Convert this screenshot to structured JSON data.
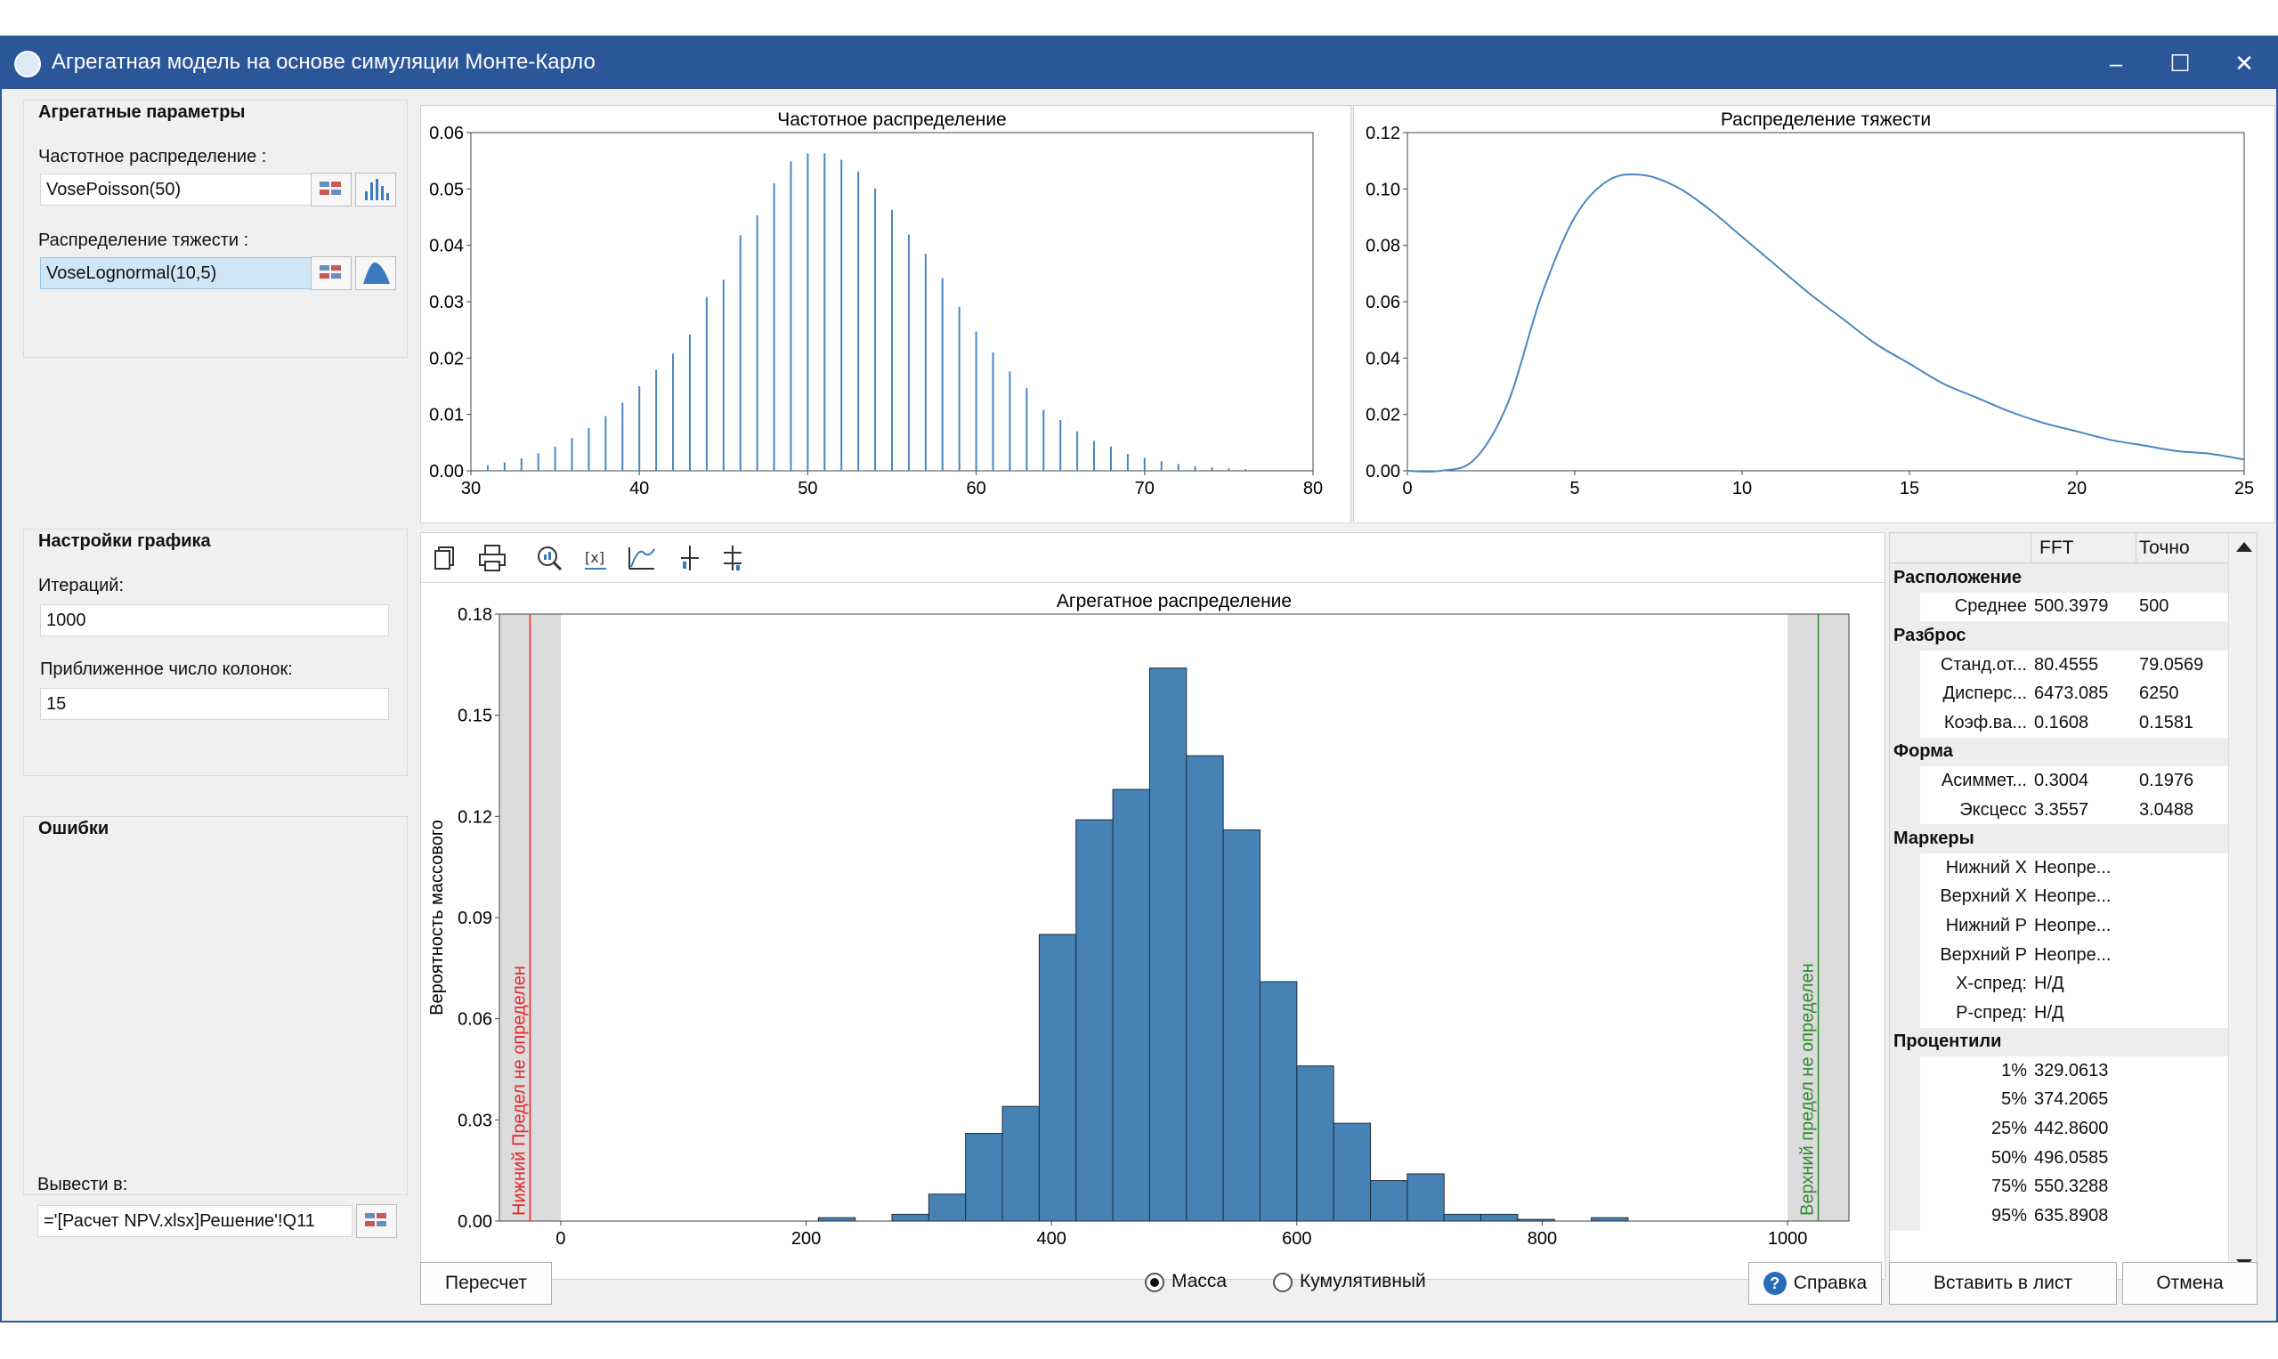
{
  "window": {
    "title": "Агрегатная модель на основе симуляции Монте-Карло",
    "minimize": "–",
    "maximize": "☐",
    "close": "✕"
  },
  "params": {
    "title": "Агрегатные параметры",
    "freq_label": "Частотное распределение :",
    "freq_value": "VosePoisson(50)",
    "sev_label": "Распределение тяжести :",
    "sev_value": "VoseLognormal(10,5)"
  },
  "graph_settings": {
    "title": "Настройки графика",
    "iter_label": "Итераций:",
    "iter_value": "1000",
    "cols_label": "Приближенное число колонок:",
    "cols_value": "15"
  },
  "errors": {
    "title": "Ошибки"
  },
  "output": {
    "label": "Вывести в:",
    "value": "='[Расчет NPV.xlsx]Решение'!Q11"
  },
  "buttons": {
    "recalc": "Пересчет",
    "help": "Справка",
    "insert": "Вставить в лист",
    "cancel": "Отмена"
  },
  "mode": {
    "mass": "Масса",
    "cumulative": "Кумулятивный",
    "selected": "mass"
  },
  "stats": {
    "col_fft": "FFT",
    "col_exact": "Точно",
    "sections": [
      {
        "title": "Расположение",
        "rows": [
          {
            "label": "Среднее",
            "fft": "500.3979",
            "exact": "500"
          }
        ]
      },
      {
        "title": "Разброс",
        "rows": [
          {
            "label": "Станд.от...",
            "fft": "80.4555",
            "exact": "79.0569"
          },
          {
            "label": "Дисперс...",
            "fft": "6473.085",
            "exact": "6250"
          },
          {
            "label": "Коэф.ва...",
            "fft": "0.1608",
            "exact": "0.1581"
          }
        ]
      },
      {
        "title": "Форма",
        "rows": [
          {
            "label": "Асиммет...",
            "fft": "0.3004",
            "exact": "0.1976"
          },
          {
            "label": "Эксцесс",
            "fft": "3.3557",
            "exact": "3.0488"
          }
        ]
      },
      {
        "title": "Маркеры",
        "rows": [
          {
            "label": "Нижний X",
            "fft": "Неопре...",
            "exact": ""
          },
          {
            "label": "Верхний X",
            "fft": "Неопре...",
            "exact": ""
          },
          {
            "label": "Нижний P",
            "fft": "Неопре...",
            "exact": ""
          },
          {
            "label": "Верхний P",
            "fft": "Неопре...",
            "exact": ""
          },
          {
            "label": "X-спред:",
            "fft": "Н/Д",
            "exact": ""
          },
          {
            "label": "P-спред:",
            "fft": "Н/Д",
            "exact": ""
          }
        ]
      },
      {
        "title": "Процентили",
        "rows": [
          {
            "label": "1%",
            "fft": "329.0613",
            "exact": ""
          },
          {
            "label": "5%",
            "fft": "374.2065",
            "exact": ""
          },
          {
            "label": "25%",
            "fft": "442.8600",
            "exact": ""
          },
          {
            "label": "50%",
            "fft": "496.0585",
            "exact": ""
          },
          {
            "label": "75%",
            "fft": "550.3288",
            "exact": ""
          },
          {
            "label": "95%",
            "fft": "635.8908",
            "exact": ""
          }
        ]
      }
    ]
  },
  "colors": {
    "accent": "#2b579a",
    "bar": "#4682b4",
    "line": "#4a86c0",
    "lower": "#e8272c",
    "upper": "#2e8b2e"
  },
  "chart_data": [
    {
      "type": "bar",
      "title": "Частотное распределение",
      "xlim": [
        30,
        80
      ],
      "ylim": [
        0,
        0.06
      ],
      "xticks": [
        "30",
        "40",
        "50",
        "60",
        "70",
        "80"
      ],
      "yticks": [
        "0.00",
        "0.01",
        "0.02",
        "0.03",
        "0.04",
        "0.05",
        "0.06"
      ],
      "x": [
        31,
        32,
        33,
        34,
        35,
        36,
        37,
        38,
        39,
        40,
        41,
        42,
        43,
        44,
        45,
        46,
        47,
        48,
        49,
        50,
        51,
        52,
        53,
        54,
        55,
        56,
        57,
        58,
        59,
        60,
        61,
        62,
        63,
        64,
        65,
        66,
        67,
        68,
        69,
        70,
        71,
        72,
        73,
        74,
        75,
        76
      ],
      "values": [
        0.001,
        0.0015,
        0.0022,
        0.0031,
        0.0043,
        0.0058,
        0.0076,
        0.0097,
        0.0121,
        0.015,
        0.0179,
        0.0208,
        0.0242,
        0.0308,
        0.0339,
        0.0418,
        0.0453,
        0.051,
        0.0549,
        0.0563,
        0.0563,
        0.0552,
        0.0531,
        0.0501,
        0.0463,
        0.0419,
        0.0385,
        0.0342,
        0.0291,
        0.0247,
        0.021,
        0.0176,
        0.0147,
        0.0108,
        0.009,
        0.007,
        0.0053,
        0.0043,
        0.003,
        0.0023,
        0.0017,
        0.0012,
        0.0008,
        0.0006,
        0.0004,
        0.0003
      ]
    },
    {
      "type": "line",
      "title": "Распределение тяжести",
      "xlim": [
        0,
        25
      ],
      "ylim": [
        0,
        0.12
      ],
      "xticks": [
        "0",
        "5",
        "10",
        "15",
        "20",
        "25"
      ],
      "yticks": [
        "0.00",
        "0.02",
        "0.04",
        "0.06",
        "0.08",
        "0.10",
        "0.12"
      ],
      "x": [
        0,
        1,
        2,
        3,
        4,
        5,
        6,
        7,
        8,
        9,
        10,
        11,
        12,
        13,
        14,
        15,
        16,
        17,
        18,
        19,
        20,
        21,
        22,
        23,
        24,
        25
      ],
      "y": [
        0,
        0,
        0.004,
        0.024,
        0.062,
        0.09,
        0.103,
        0.105,
        0.101,
        0.093,
        0.083,
        0.073,
        0.063,
        0.054,
        0.045,
        0.038,
        0.031,
        0.026,
        0.021,
        0.017,
        0.014,
        0.011,
        0.009,
        0.007,
        0.006,
        0.004
      ]
    },
    {
      "type": "bar",
      "title": "Агрегатное распределение",
      "ylabel": "Вероятность массового",
      "xlim": [
        -50,
        1050
      ],
      "ylim": [
        0,
        0.18
      ],
      "xticks": [
        "0",
        "200",
        "400",
        "600",
        "800",
        "1000"
      ],
      "yticks": [
        "0.00",
        "0.03",
        "0.06",
        "0.09",
        "0.12",
        "0.15",
        "0.18"
      ],
      "bin_width": 30,
      "bins": [
        210,
        270,
        300,
        330,
        360,
        390,
        420,
        450,
        480,
        510,
        540,
        570,
        600,
        630,
        660,
        690,
        720,
        750,
        780,
        840
      ],
      "values": [
        0.001,
        0.002,
        0.008,
        0.026,
        0.034,
        0.085,
        0.119,
        0.128,
        0.164,
        0.138,
        0.116,
        0.071,
        0.046,
        0.029,
        0.012,
        0.014,
        0.002,
        0.002,
        0.0005,
        0.001
      ],
      "lower_marker": "Нижний Предел не определен",
      "upper_marker": "Верхний предел не определен"
    }
  ]
}
